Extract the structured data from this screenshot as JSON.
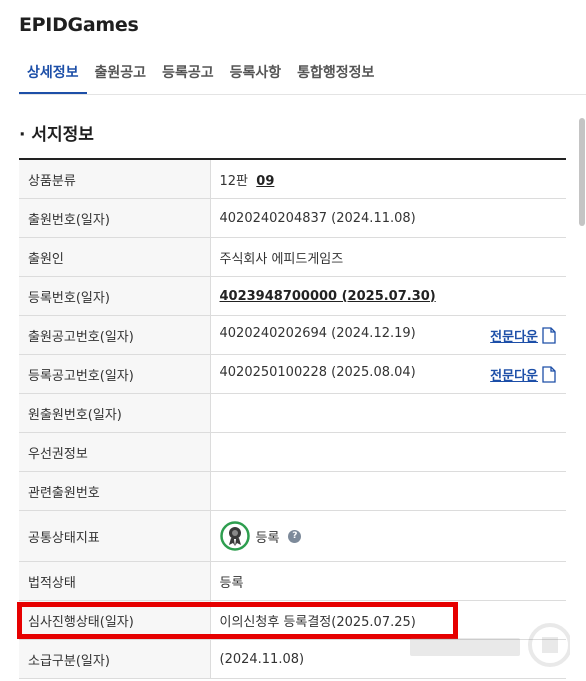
{
  "app": {
    "title": "EPIDGames"
  },
  "tabs": [
    {
      "label": "상세정보",
      "active": true
    },
    {
      "label": "출원공고"
    },
    {
      "label": "등록공고"
    },
    {
      "label": "등록사항"
    },
    {
      "label": "통합행정정보"
    }
  ],
  "section": {
    "title": "· 서지정보"
  },
  "rows": {
    "class": {
      "label": "상품분류",
      "edition": "12판",
      "value": "09"
    },
    "app_no": {
      "label": "출원번호(일자)",
      "value": "4020240204837 (2024.11.08)"
    },
    "applicant": {
      "label": "출원인",
      "value": "주식회사 에피드게임즈"
    },
    "reg_no": {
      "label": "등록번호(일자)",
      "value": "4023948700000 (2025.07.30)"
    },
    "app_pub_no": {
      "label": "출원공고번호(일자)",
      "value": "4020240202694 (2024.12.19)",
      "download": "전문다운"
    },
    "reg_pub_no": {
      "label": "등록공고번호(일자)",
      "value": "4020250100228 (2025.08.04)",
      "download": "전문다운"
    },
    "orig_app_no": {
      "label": "원출원번호(일자)",
      "value": ""
    },
    "priority": {
      "label": "우선권정보",
      "value": ""
    },
    "related_app": {
      "label": "관련출원번호",
      "value": ""
    },
    "common_status": {
      "label": "공통상태지표",
      "value": "등록",
      "help": "?"
    },
    "legal_status": {
      "label": "법적상태",
      "value": "등록"
    },
    "exam_status": {
      "label": "심사진행상태(일자)",
      "value": "이의신청후 등록결정(2025.07.25)"
    },
    "retro_class": {
      "label": "소급구분(일자)",
      "value": "(2024.11.08)"
    }
  },
  "colors": {
    "accent": "#1d4fa8",
    "highlight": "#e60000",
    "seal": "#2e9e4f"
  },
  "icons": {
    "download": "document-icon",
    "status": "seal-badge-icon",
    "help": "question-icon"
  }
}
